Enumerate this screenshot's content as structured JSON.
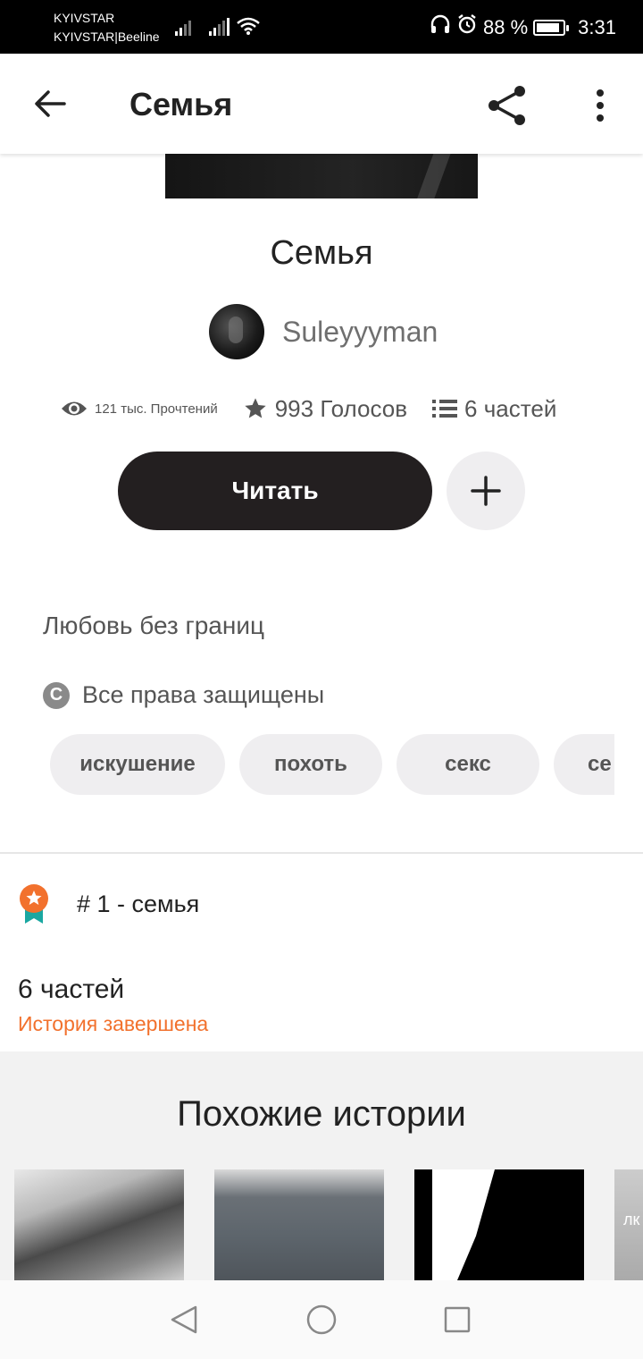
{
  "status_bar": {
    "carrier_1": "KYIVSTAR",
    "carrier_2": "KYIVSTAR|Beeline",
    "battery_percent": "88 %",
    "battery_level": 0.88,
    "time": "3:31"
  },
  "app_bar": {
    "title": "Семья"
  },
  "story": {
    "title": "Семья",
    "author": "Suleyyyman",
    "views": "121 тыс. Прочтений",
    "votes": "993 Голосов",
    "parts": "6 частей",
    "read_label": "Читать",
    "description": "Любовь без границ",
    "copyright": "Все права защищены",
    "tags": [
      "искушение",
      "похоть",
      "секс",
      "се"
    ]
  },
  "rank": {
    "text": "# 1 - семья"
  },
  "parts_section": {
    "count": "6 частей",
    "status": "История завершена"
  },
  "similar": {
    "title": "Похожие истории",
    "partial_cover_text": "лк"
  },
  "colors": {
    "accent": "#f2712d",
    "button_dark": "#231f20",
    "chip_bg": "#efeef0"
  }
}
